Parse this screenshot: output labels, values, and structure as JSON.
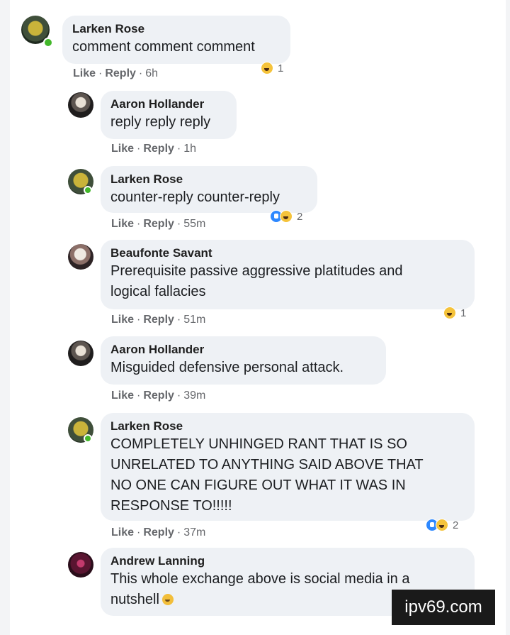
{
  "comments": [
    {
      "author": "Larken Rose",
      "text": "comment comment comment",
      "like": "Like",
      "reply": "Reply",
      "time": "6h",
      "reaction_count": "1",
      "reactions": [
        "haha"
      ]
    },
    {
      "author": "Aaron Hollander",
      "text": "reply reply reply",
      "like": "Like",
      "reply": "Reply",
      "time": "1h"
    },
    {
      "author": "Larken Rose",
      "text": "counter-reply counter-reply",
      "like": "Like",
      "reply": "Reply",
      "time": "55m",
      "reaction_count": "2",
      "reactions": [
        "like",
        "haha"
      ]
    },
    {
      "author": "Beaufonte Savant",
      "text_line1": "Prerequisite passive aggressive platitudes and",
      "text_line2": "logical fallacies",
      "like": "Like",
      "reply": "Reply",
      "time": "51m",
      "reaction_count": "1",
      "reactions": [
        "haha"
      ]
    },
    {
      "author": "Aaron Hollander",
      "text": "Misguided defensive personal attack.",
      "like": "Like",
      "reply": "Reply",
      "time": "39m"
    },
    {
      "author": "Larken Rose",
      "text_line1": "COMPLETELY UNHINGED RANT THAT IS SO",
      "text_line2": "UNRELATED TO ANYTHING SAID ABOVE THAT",
      "text_line3": "NO ONE CAN FIGURE OUT WHAT IT WAS IN",
      "text_line4": "RESPONSE TO!!!!!",
      "like": "Like",
      "reply": "Reply",
      "time": "37m",
      "reaction_count": "2",
      "reactions": [
        "like",
        "haha"
      ]
    },
    {
      "author": "Andrew Lanning",
      "text_line1": "This whole exchange above is social media in a",
      "text_line2": "nutshell",
      "emoji": "laughing-emoji"
    }
  ],
  "separator": "·",
  "watermark": "ipv69.com"
}
